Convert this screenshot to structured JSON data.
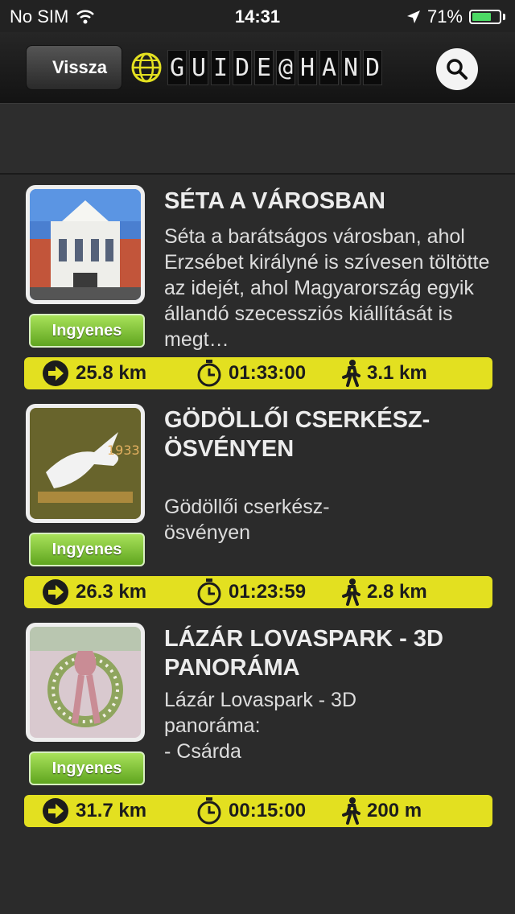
{
  "status": {
    "carrier": "No SIM",
    "time": "14:31",
    "battery": "71%",
    "battery_level": 0.71
  },
  "nav": {
    "back_label": "Vissza",
    "logo_letters": [
      "G",
      "U",
      "I",
      "D",
      "E",
      "@",
      "H",
      "A",
      "N",
      "D"
    ]
  },
  "items": [
    {
      "title": "SÉTA A VÁROSBAN",
      "description": "Séta a barátságos városban, ahol Erzsébet királyné is szívesen töltötte az idejét, ahol Magyarország egyik állandó szecessziós kiállítását is megt…",
      "free_label": "Ingyenes",
      "distance": "25.8 km",
      "duration": "01:33:00",
      "walk": "3.1 km"
    },
    {
      "title": "GÖDÖLLŐI CSERKÉSZ-ÖSVÉNYEN",
      "description": "Gödöllői cserkész-\nösvényen",
      "free_label": "Ingyenes",
      "distance": "26.3 km",
      "duration": "01:23:59",
      "walk": "2.8 km"
    },
    {
      "title": "LÁZÁR LOVASPARK - 3D PANORÁMA",
      "description": "Lázár Lovaspark - 3D\npanoráma:\n - Csárda",
      "free_label": "Ingyenes",
      "distance": "31.7 km",
      "duration": "00:15:00",
      "walk": "200 m"
    }
  ]
}
